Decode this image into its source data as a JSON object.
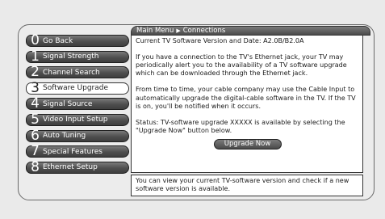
{
  "title_bar": {
    "menu": "Main Menu",
    "separator_icon": "triangle-right",
    "section": "Connections"
  },
  "side_menu": {
    "items": [
      {
        "number": "0",
        "label": "Go Back"
      },
      {
        "number": "1",
        "label": "Signal Strength"
      },
      {
        "number": "2",
        "label": "Channel Search"
      },
      {
        "number": "3",
        "label": "Software Upgrade"
      },
      {
        "number": "4",
        "label": "Signal Source"
      },
      {
        "number": "5",
        "label": "Video Input Setup"
      },
      {
        "number": "6",
        "label": "Auto Tuning"
      },
      {
        "number": "7",
        "label": "Special Features"
      },
      {
        "number": "8",
        "label": "Ethernet Setup"
      }
    ],
    "selected_index": 3
  },
  "content": {
    "version_line": "Current TV Software Version and Date: A2.0B/B2.0A",
    "paragraph_1": "If you have a connection to the TV's Ethernet jack, your TV may periodically alert you to the availability of a TV software upgrade which can be downloaded through the Ethernet jack.",
    "paragraph_2": "From time to time, your cable company may use the Cable Input to automatically upgrade the digital-cable software in the TV. If the TV is on, you'll be notified when it occurs.",
    "status": "Status: TV-software upgrade XXXXX is available by selecting the \"Upgrade Now\" button below.",
    "upgrade_button_label": "Upgrade Now"
  },
  "help": {
    "text": "You can view your current TV-software version and check if a new software version is available."
  },
  "colors": {
    "menu_button": "#4e4e4e",
    "selected_button": "#ffffff",
    "panel_background": "#ffffff",
    "screen_background": "#eaeaea"
  }
}
